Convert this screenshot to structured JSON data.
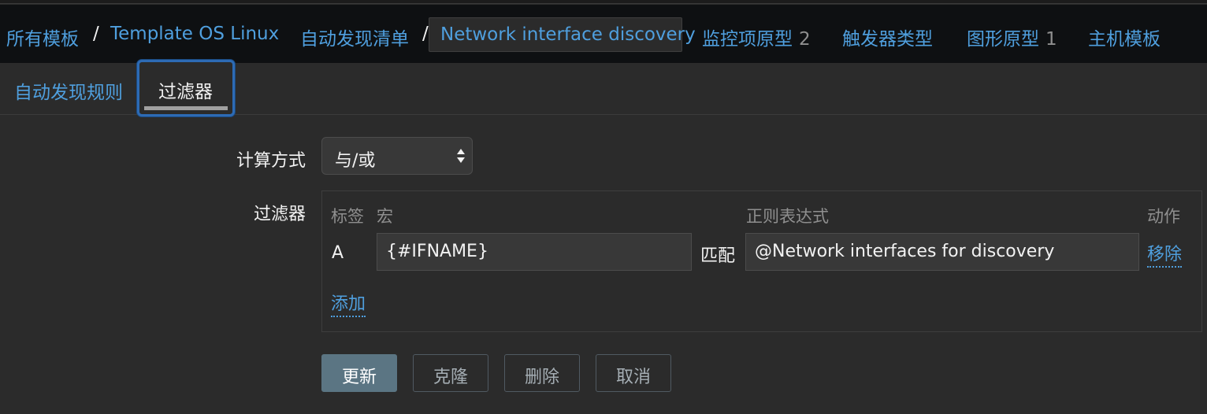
{
  "breadcrumb": {
    "all_templates": "所有模板",
    "template": "Template OS Linux",
    "discovery_list": "自动发现清单",
    "current": "Network interface discovery",
    "separator": "/"
  },
  "nav_links": {
    "item_prototypes": "监控项原型",
    "item_prototypes_count": "2",
    "trigger_types": "触发器类型",
    "graph_prototypes": "图形原型",
    "graph_prototypes_count": "1",
    "host_templates": "主机模板"
  },
  "tabs": {
    "discovery_rule": "自动发现规则",
    "filters": "过滤器"
  },
  "form": {
    "calc_label": "计算方式",
    "calc_value": "与/或",
    "filters_label": "过滤器",
    "headers": {
      "label": "标签",
      "macro": "宏",
      "regex": "正则表达式",
      "action": "动作"
    },
    "row": {
      "label": "A",
      "macro_value": "{#IFNAME}",
      "operator": "匹配",
      "regex_value": "@Network interfaces for discovery",
      "remove": "移除"
    },
    "add": "添加"
  },
  "buttons": {
    "update": "更新",
    "clone": "克隆",
    "delete": "删除",
    "cancel": "取消"
  },
  "colors": {
    "link": "#4f9fde",
    "background": "#2b2b2b",
    "nav_background": "#0e1012",
    "active_tab_border": "#2d6bb5",
    "primary_button": "#5b7583"
  }
}
